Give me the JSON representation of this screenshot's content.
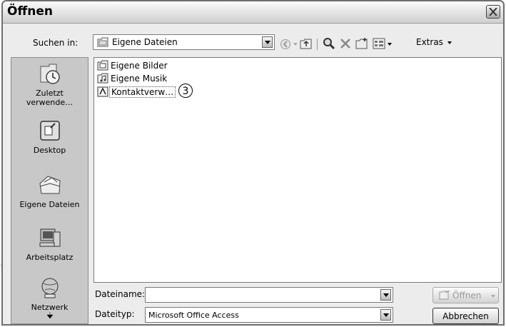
{
  "window": {
    "title": "Öffnen"
  },
  "lookin": {
    "label": "Suchen in:",
    "value": "Eigene Dateien"
  },
  "toolbar": {
    "extras_label": "Extras"
  },
  "places": [
    {
      "label": "Zuletzt verwende…"
    },
    {
      "label": "Desktop"
    },
    {
      "label": "Eigene Dateien"
    },
    {
      "label": "Arbeitsplatz"
    },
    {
      "label": "Netzwerk"
    }
  ],
  "files": [
    {
      "name": "Eigene Bilder"
    },
    {
      "name": "Eigene Musik"
    },
    {
      "name": "Kontaktverw…"
    }
  ],
  "callout": {
    "number": "3"
  },
  "filename": {
    "label": "Dateiname:",
    "value": ""
  },
  "filetype": {
    "label": "Dateityp:",
    "value": "Microsoft Office Access"
  },
  "buttons": {
    "open": "Öffnen",
    "cancel": "Abbrechen"
  }
}
